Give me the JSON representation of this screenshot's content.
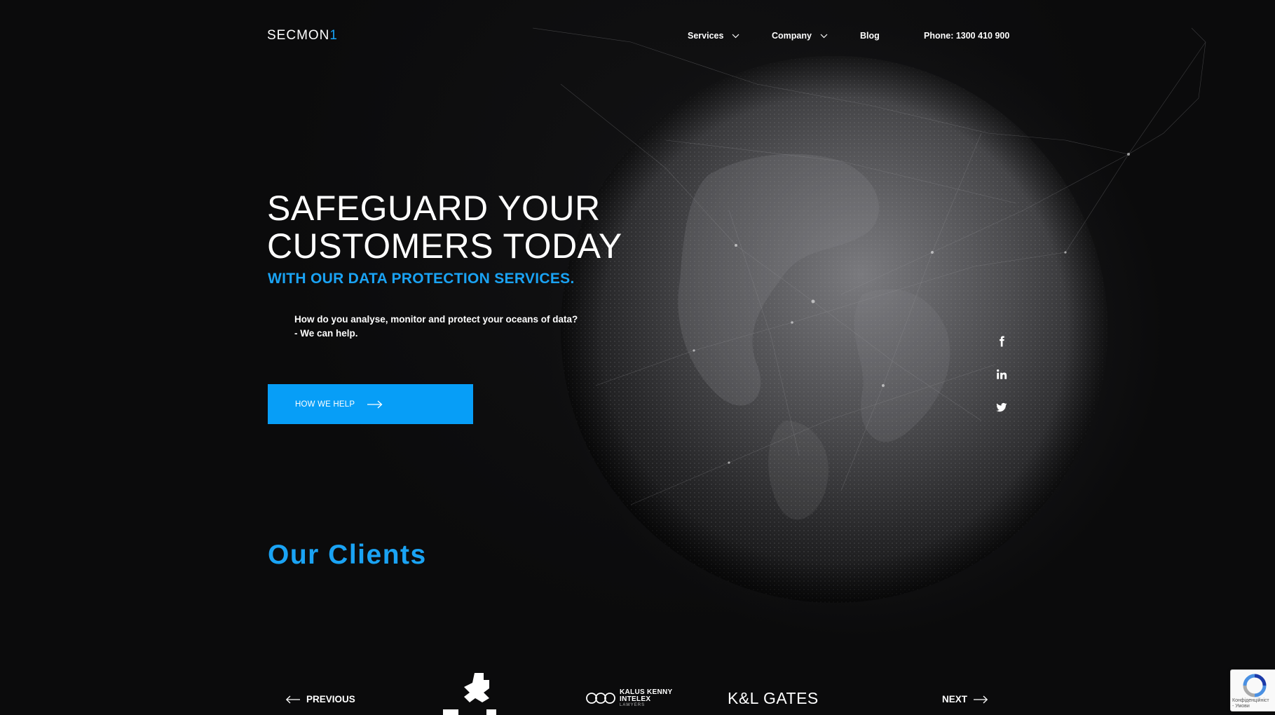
{
  "header": {
    "logo_text": "SECMON",
    "logo_suffix": "1",
    "nav": [
      {
        "label": "Services",
        "has_dropdown": true
      },
      {
        "label": "Company",
        "has_dropdown": true
      },
      {
        "label": "Blog",
        "has_dropdown": false
      }
    ],
    "phone": "Phone: 1300 410 900"
  },
  "hero": {
    "title_line1": "SAFEGUARD YOUR",
    "title_line2": "CUSTOMERS TODAY",
    "subtitle": "WITH OUR DATA PROTECTION SERVICES.",
    "description_line1": "How do you analyse, monitor and protect your oceans of data?",
    "description_line2": "- We can help.",
    "cta_label": "HOW WE HELP"
  },
  "social": [
    {
      "name": "facebook-icon",
      "glyph": "f"
    },
    {
      "name": "linkedin-icon",
      "glyph": "in"
    },
    {
      "name": "twitter-icon",
      "glyph": "bird"
    }
  ],
  "clients": {
    "title": "Our Clients",
    "previous_label": "PREVIOUS",
    "next_label": "NEXT",
    "logos": [
      {
        "name": "client-logo-1"
      },
      {
        "name": "kalus-kenny-intelex",
        "line1": "KALUS KENNY",
        "line2": "INTELEX",
        "line3": "LAWYERS"
      },
      {
        "name": "kl-gates",
        "text": "K&L GATES"
      }
    ]
  },
  "recaptcha": {
    "text_line1": "Конфіденційніст",
    "text_line2": "- Умови"
  },
  "colors": {
    "accent": "#1aa3f4",
    "button": "#079ef7",
    "background": "#0b0b0c",
    "text": "#ffffff"
  }
}
